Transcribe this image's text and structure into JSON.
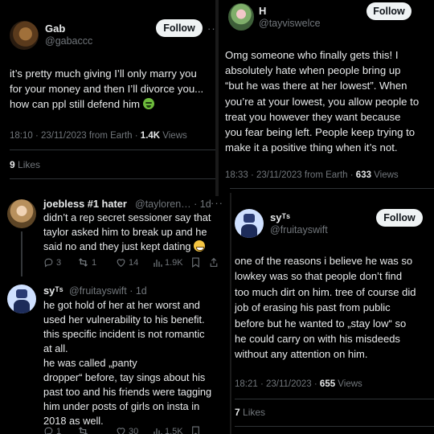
{
  "panel1": {
    "name": "Gab",
    "handle": "@gabaccc",
    "follow_label": "Follow",
    "more": "···",
    "lines": [
      "it’s pretty much giving I’ll only marry you",
      "for your money and then I’ll divorce you...",
      "how can ppl still defend him"
    ],
    "emoji_icon": "nauseated-face-icon",
    "time": "18:10 · 23/11/2023 from Earth · ",
    "views_count": "1.4K",
    "views_label": " Views",
    "likes_count": "9",
    "likes_label": " Likes"
  },
  "panel2": {
    "name": "H",
    "handle": "@tayviswelce",
    "follow_label": "Follow",
    "lines": [
      "Omg someone who finally gets this! I",
      "absolutely hate when people bring up",
      "“but he was there at her lowest”. When",
      "you’re at your lowest, you allow people to",
      "treat you however they want because",
      "you fear being left. People keep trying to",
      "make it a positive thing when it’s not."
    ],
    "time": "18:33 · 23/11/2023 from Earth · ",
    "views_count": "633",
    "views_label": " Views"
  },
  "panel3": {
    "reply1": {
      "name": "joebless #1 hater",
      "handle": "@tayloren… · 1d",
      "more": "···",
      "lines": [
        "didn’t a rep secret sessioner say that",
        "taylor asked him to break up and he",
        "said no and they just kept dating"
      ],
      "emoji_icon": "grimacing-sweat-icon",
      "replies": "3",
      "retweets": "1",
      "likes": "14",
      "views": "1.9K"
    },
    "reply2": {
      "name": "syᵀˢ",
      "handle": "@fruitayswift · 1d",
      "lines": [
        "he got hold of her at her worst and",
        "used her vulnerability to his benefit.",
        "this specific incident is not romantic",
        "at all.",
        "he was called „panty",
        "dropper“ before, tay sings about his",
        "past too and his friends were tagging",
        "him under posts of girls on insta in",
        "2018 as well."
      ],
      "replies": "1",
      "retweets": "",
      "likes": "30",
      "views": "1.5K"
    }
  },
  "panel4": {
    "name": "syᵀˢ",
    "handle": "@fruitayswift",
    "follow_label": "Follow",
    "lines": [
      "one of the reasons i believe he was so",
      "lowkey was so that people don’t find",
      "too much dirt on him. tree of course did",
      "job of erasing his past from public",
      "before but he wanted to „stay low“ so",
      "he could carry on with his misdeeds",
      "without any attention on him."
    ],
    "time": "18:21 · 23/11/2023 · ",
    "views_count": "655",
    "views_label": " Views",
    "likes_count": "7",
    "likes_label": " Likes"
  },
  "colors": {
    "background": "#000000",
    "text": "#e7e9ea",
    "muted": "#71767b",
    "button_bg": "#eff3f4",
    "button_text": "#0f1419"
  }
}
